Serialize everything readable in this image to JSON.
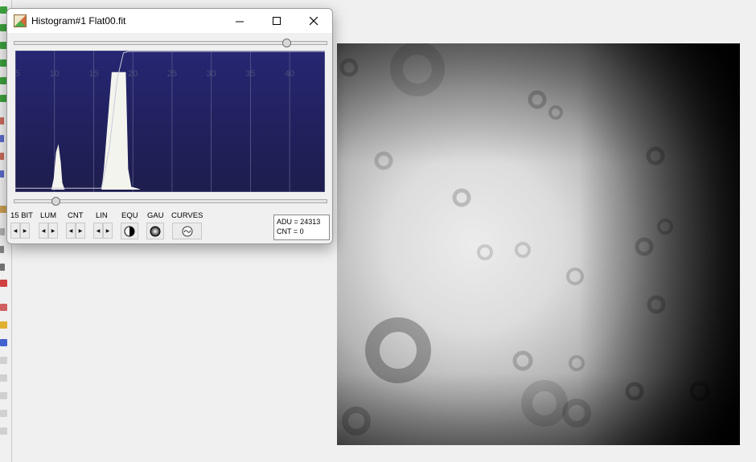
{
  "window": {
    "title": "Histogram#1 Flat00.fit"
  },
  "controls": {
    "bit": {
      "label": "15 BIT"
    },
    "lum": {
      "label": "LUM"
    },
    "cnt": {
      "label": "CNT"
    },
    "lin": {
      "label": "LIN"
    },
    "equ": {
      "label": "EQU"
    },
    "gau": {
      "label": "GAU"
    },
    "curves": {
      "label": "CURVES"
    }
  },
  "info": {
    "adu": "ADU = 24313",
    "cnt": "CNT = 0"
  },
  "chart_data": {
    "type": "area",
    "x_ticks": [
      "5",
      "10",
      "15",
      "20",
      "25",
      "30",
      "35",
      "40"
    ],
    "xlim": [
      5,
      44.5
    ],
    "x": [
      5,
      9.6,
      9.9,
      10.2,
      10.5,
      10.8,
      11.0,
      11.3,
      16.0,
      16.3,
      16.8,
      17.3,
      17.8,
      18.3,
      18.8,
      19.1,
      19.4,
      19.8,
      20.5,
      21.0,
      44.5
    ],
    "y": [
      0,
      0,
      0.08,
      0.27,
      0.33,
      0.2,
      0.05,
      0,
      0,
      0.15,
      0.5,
      0.85,
      0.85,
      0.85,
      0.85,
      0.85,
      0.15,
      0.02,
      0.01,
      0,
      0
    ],
    "cumulative_x": [
      5,
      16.0,
      17.0,
      18.0,
      18.8,
      19.4,
      44.5
    ],
    "cumulative_y": [
      0.01,
      0.01,
      0.3,
      0.8,
      0.99,
      1.0,
      1.0
    ],
    "background_gradient": [
      "#262673",
      "#1d1d4d"
    ],
    "fill_color": "#f4f4ee"
  }
}
